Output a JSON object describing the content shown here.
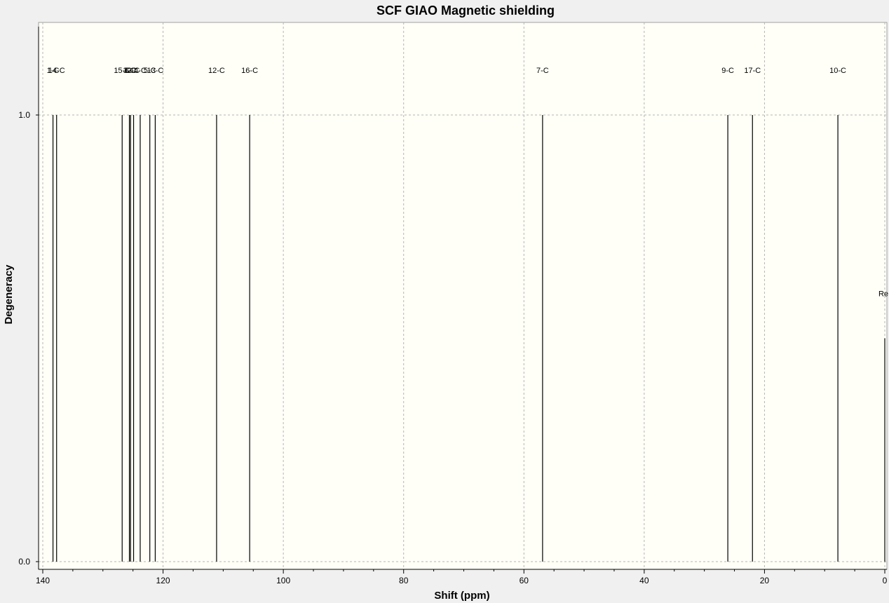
{
  "window": {
    "background": "#f0f0f0",
    "plot_background": "#fffff7",
    "grid_color": "#b4b4b4"
  },
  "chart_data": {
    "type": "bar",
    "title": "SCF GIAO Magnetic shielding",
    "xlabel": "Shift (ppm)",
    "ylabel": "Degeneracy",
    "xlim": [
      140,
      0
    ],
    "ylim": [
      0,
      1.0
    ],
    "x_ticks": [
      140,
      120,
      100,
      80,
      60,
      40,
      20,
      0
    ],
    "y_ticks": [
      0.0,
      1.0
    ],
    "y_tick_labels": [
      "0.0",
      "1.0"
    ],
    "grid": true,
    "peaks": [
      {
        "label": "1-C",
        "shift": 138.3,
        "degeneracy": 1.0
      },
      {
        "label": "14-C",
        "shift": 137.7,
        "degeneracy": 1.0
      },
      {
        "label": "15-C",
        "shift": 126.8,
        "degeneracy": 1.0
      },
      {
        "label": "3-C",
        "shift": 125.6,
        "degeneracy": 1.0
      },
      {
        "label": "8-C",
        "shift": 125.4,
        "degeneracy": 1.0
      },
      {
        "label": "2-C",
        "shift": 124.9,
        "degeneracy": 1.0
      },
      {
        "label": "4-C",
        "shift": 123.8,
        "degeneracy": 1.0
      },
      {
        "label": "5-C",
        "shift": 122.2,
        "degeneracy": 1.0
      },
      {
        "label": "13-C",
        "shift": 121.3,
        "degeneracy": 1.0
      },
      {
        "label": "12-C",
        "shift": 111.1,
        "degeneracy": 1.0
      },
      {
        "label": "16-C",
        "shift": 105.6,
        "degeneracy": 1.0
      },
      {
        "label": "7-C",
        "shift": 56.9,
        "degeneracy": 1.0
      },
      {
        "label": "9-C",
        "shift": 26.1,
        "degeneracy": 1.0
      },
      {
        "label": "17-C",
        "shift": 22.0,
        "degeneracy": 1.0
      },
      {
        "label": "10-C",
        "shift": 7.8,
        "degeneracy": 1.0
      },
      {
        "label": "Re",
        "shift": 0.0,
        "degeneracy": 0.5
      }
    ]
  }
}
